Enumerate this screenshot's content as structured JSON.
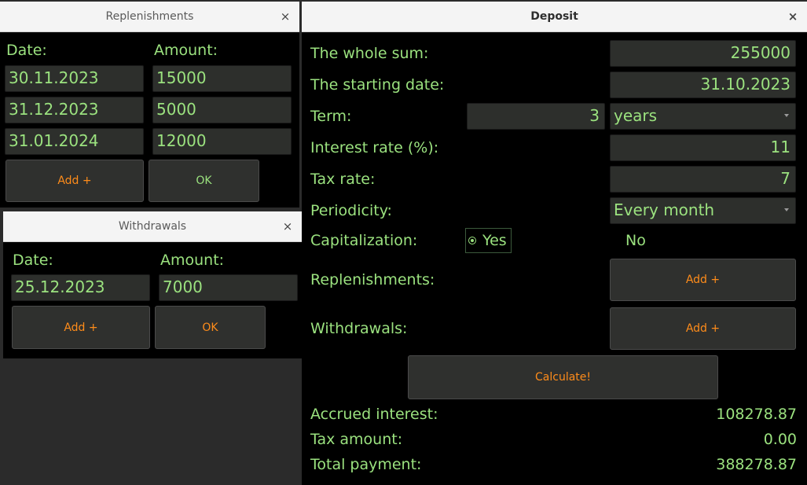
{
  "replenishments": {
    "title": "Replenishments",
    "close": "×",
    "date_header": "Date:",
    "amount_header": "Amount:",
    "rows": [
      {
        "date": "30.11.2023",
        "amount": "15000"
      },
      {
        "date": "31.12.2023",
        "amount": "5000"
      },
      {
        "date": "31.01.2024",
        "amount": "12000"
      }
    ],
    "add_label": "Add +",
    "ok_label": "OK"
  },
  "withdrawals": {
    "title": "Withdrawals",
    "close": "×",
    "date_header": "Date:",
    "amount_header": "Amount:",
    "rows": [
      {
        "date": "25.12.2023",
        "amount": "7000"
      }
    ],
    "add_label": "Add +",
    "ok_label": "OK"
  },
  "deposit": {
    "title": "Deposit",
    "close": "×",
    "whole_sum": {
      "label": "The whole sum:",
      "value": "255000"
    },
    "starting_date": {
      "label": "The starting date:",
      "value": "31.10.2023"
    },
    "term": {
      "label": "Term:",
      "value": "3",
      "unit": "years"
    },
    "interest_rate": {
      "label": "Interest rate (%):",
      "value": "11"
    },
    "tax_rate": {
      "label": "Tax rate:",
      "value": "7"
    },
    "periodicity": {
      "label": "Periodicity:",
      "value": "Every month"
    },
    "capitalization": {
      "label": "Capitalization:",
      "yes": "Yes",
      "no": "No",
      "selected": "Yes"
    },
    "replenishments": {
      "label": "Replenishments:",
      "button": "Add +"
    },
    "withdrawals": {
      "label": "Withdrawals:",
      "button": "Add +"
    },
    "calculate_label": "Calculate!",
    "results": {
      "accrued_interest": {
        "label": "Accrued interest:",
        "value": "108278.87"
      },
      "tax_amount": {
        "label": "Tax amount:",
        "value": "0.00"
      },
      "total_payment": {
        "label": "Total payment:",
        "value": "388278.87"
      }
    }
  },
  "colors": {
    "text_green": "#9be27f",
    "button_orange": "#ff8c1a",
    "field_bg": "#2d2f2c",
    "window_bg": "#000000",
    "desktop_bg": "#2b2b2b"
  }
}
